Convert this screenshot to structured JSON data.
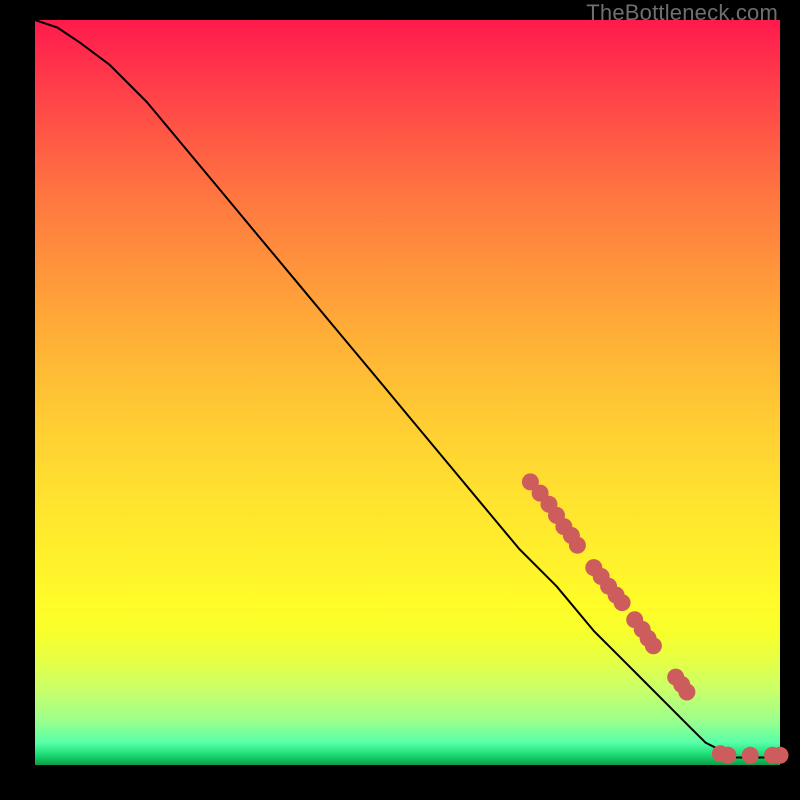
{
  "watermark": "TheBottleneck.com",
  "chart_data": {
    "type": "line",
    "title": "",
    "xlabel": "",
    "ylabel": "",
    "xlim": [
      0,
      100
    ],
    "ylim": [
      0,
      100
    ],
    "grid": false,
    "legend": false,
    "series": [
      {
        "name": "curve",
        "x": [
          0,
          3,
          6,
          10,
          15,
          20,
          25,
          30,
          35,
          40,
          45,
          50,
          55,
          60,
          65,
          70,
          75,
          80,
          85,
          88,
          90,
          92,
          94,
          96,
          98,
          100
        ],
        "y": [
          100,
          99,
          97,
          94,
          89,
          83,
          77,
          71,
          65,
          59,
          53,
          47,
          41,
          35,
          29,
          24,
          18,
          13,
          8,
          5,
          3,
          2,
          1,
          1,
          1,
          1
        ]
      }
    ],
    "overlay_points": {
      "name": "highlight-dots",
      "color": "#cd5c5c",
      "points": [
        {
          "x": 66.5,
          "y": 38.0
        },
        {
          "x": 67.8,
          "y": 36.5
        },
        {
          "x": 69.0,
          "y": 35.0
        },
        {
          "x": 70.0,
          "y": 33.5
        },
        {
          "x": 71.0,
          "y": 32.0
        },
        {
          "x": 72.0,
          "y": 30.8
        },
        {
          "x": 72.8,
          "y": 29.5
        },
        {
          "x": 75.0,
          "y": 26.5
        },
        {
          "x": 76.0,
          "y": 25.3
        },
        {
          "x": 77.0,
          "y": 24.0
        },
        {
          "x": 78.0,
          "y": 22.8
        },
        {
          "x": 78.8,
          "y": 21.8
        },
        {
          "x": 80.5,
          "y": 19.5
        },
        {
          "x": 81.5,
          "y": 18.2
        },
        {
          "x": 82.3,
          "y": 17.0
        },
        {
          "x": 83.0,
          "y": 16.0
        },
        {
          "x": 86.0,
          "y": 11.8
        },
        {
          "x": 86.8,
          "y": 10.8
        },
        {
          "x": 87.5,
          "y": 9.8
        },
        {
          "x": 92.0,
          "y": 1.5
        },
        {
          "x": 93.0,
          "y": 1.3
        },
        {
          "x": 96.0,
          "y": 1.3
        },
        {
          "x": 99.0,
          "y": 1.3
        },
        {
          "x": 100.0,
          "y": 1.3
        }
      ]
    }
  }
}
